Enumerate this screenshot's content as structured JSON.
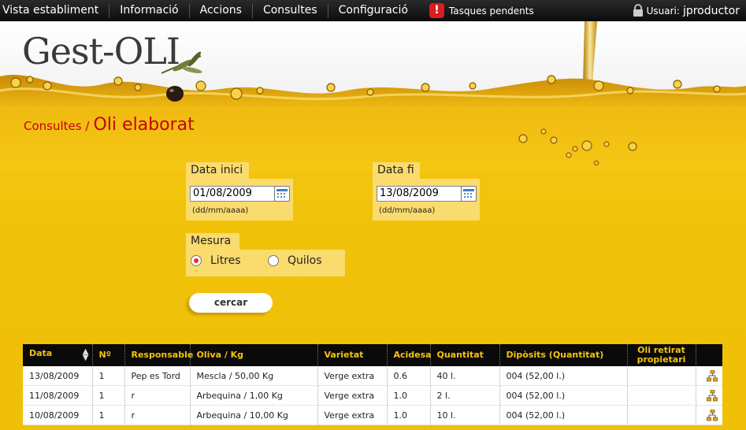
{
  "nav": {
    "items": [
      "Vista establiment",
      "Informació",
      "Accions",
      "Consultes",
      "Configuració"
    ],
    "tasks_label": "Tasques pendents",
    "user_label": "Usuari:",
    "user_name": "jproductor"
  },
  "logo": {
    "text": "Gest-OLI"
  },
  "breadcrumb": {
    "section": "Consultes /",
    "title": "Oli elaborat"
  },
  "form": {
    "start_label": "Data inici",
    "start_value": "01/08/2009",
    "end_label": "Data fi",
    "end_value": "13/08/2009",
    "date_hint": "(dd/mm/aaaa)",
    "measure_label": "Mesura",
    "option_litres": "Litres",
    "option_quilos": "Quilos",
    "selected_measure": "Litres",
    "search_button": "cercar"
  },
  "table": {
    "headers": [
      "Data",
      "Nº",
      "Responsable",
      "Oliva / Kg",
      "Varietat",
      "Acidesa",
      "Quantitat",
      "Dipòsits (Quantitat)",
      "Oli retirat propietari",
      ""
    ],
    "rows": [
      [
        "13/08/2009",
        "1",
        "Pep es Tord",
        "Mescla / 50,00 Kg",
        "Verge extra",
        "0.6",
        "40 l.",
        "004 (52,00 l.)",
        ""
      ],
      [
        "11/08/2009",
        "1",
        "r",
        "Arbequina / 1,00 Kg",
        "Verge extra",
        "1.0",
        "2 l.",
        "004 (52,00 l.)",
        ""
      ],
      [
        "10/08/2009",
        "1",
        "r",
        "Arbequina / 10,00 Kg",
        "Verge extra",
        "1.0",
        "10 l.",
        "004 (52,00 l.)",
        ""
      ]
    ]
  },
  "colors": {
    "accent_red": "#c8000c",
    "header_gold": "#f4c40f",
    "oil_yellow": "#f2c40c"
  }
}
